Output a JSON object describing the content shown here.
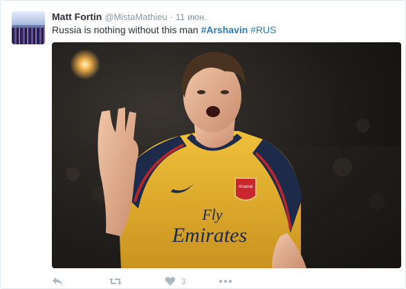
{
  "tweet": {
    "author_name": "Matt Fortin",
    "author_handle": "@MistaMathieu",
    "separator": "·",
    "time": "11 июн.",
    "text_plain": "Russia is nothing without this man ",
    "hashtag_1": "#Arshavin",
    "text_between": " ",
    "hashtag_2": "#RUS",
    "media_alt": "Football player in yellow Arsenal away kit celebrating",
    "shirt_text_line1": "Fly",
    "shirt_text_line2": "Emirates",
    "badge_text": "Arsenal"
  },
  "actions": {
    "reply_icon": "reply-icon",
    "retweet_icon": "retweet-icon",
    "like_icon": "heart-icon",
    "like_count": "3",
    "more_icon": "more-icon"
  },
  "colors": {
    "link": "#2b7bb9",
    "muted": "#8899a6",
    "action": "#aab8c2",
    "text": "#292f33",
    "shirt_yellow": "#e7b531",
    "shirt_navy": "#1e2a4a",
    "shirt_red": "#b3272f"
  }
}
